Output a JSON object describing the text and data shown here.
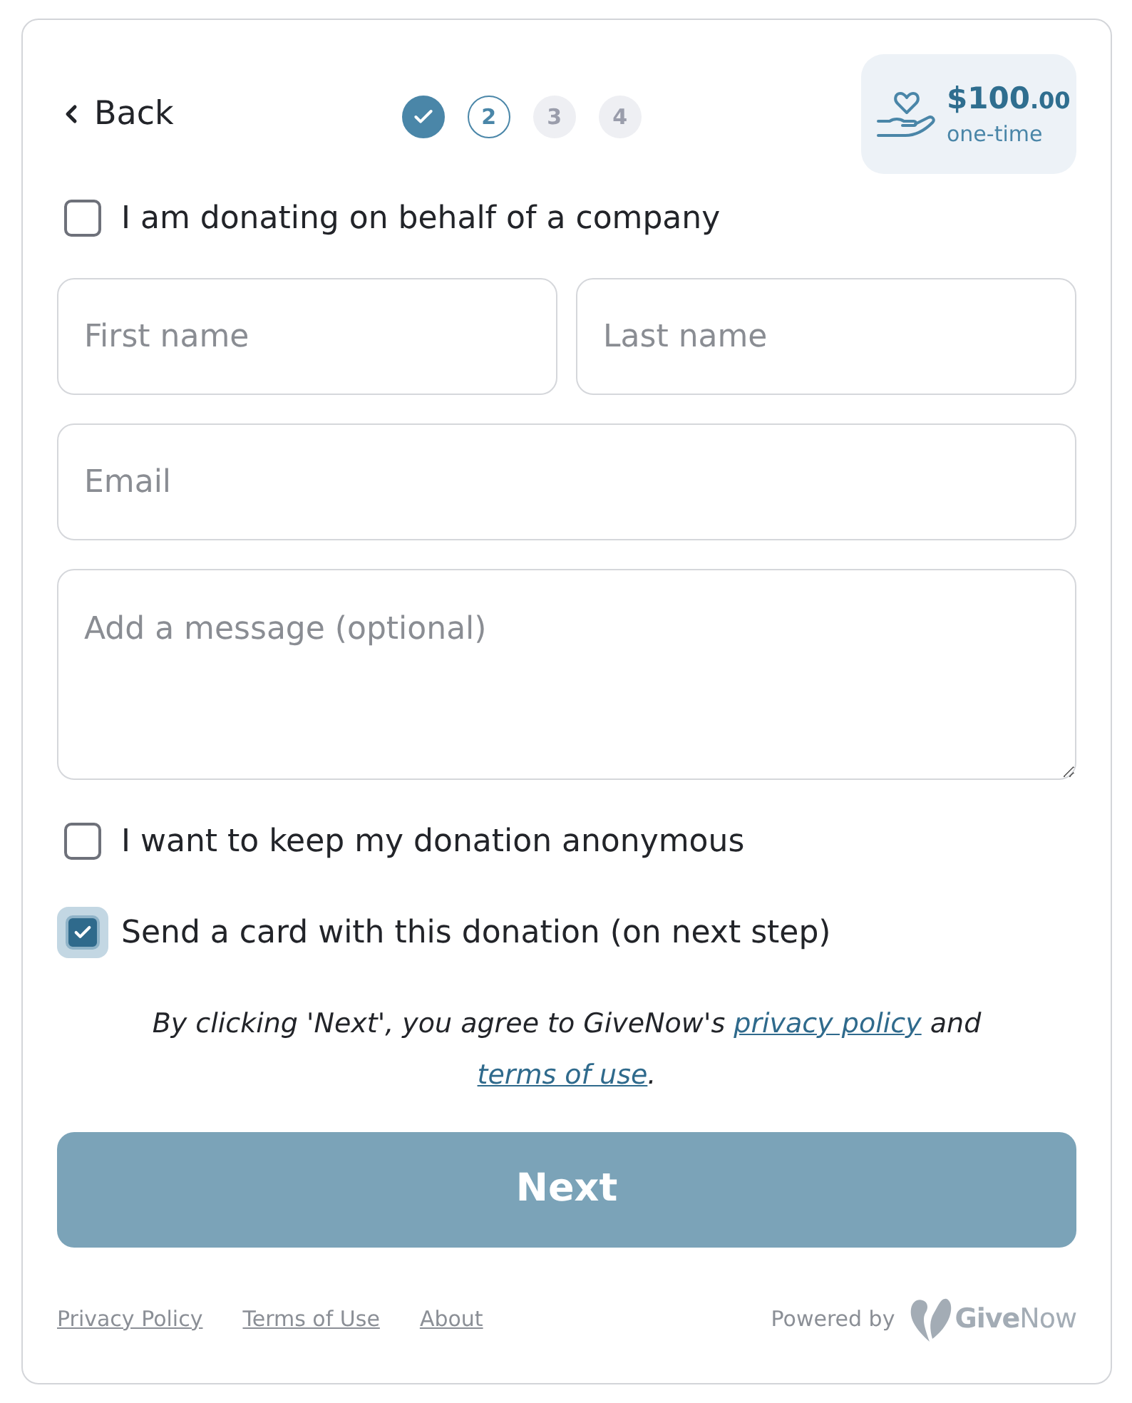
{
  "header": {
    "back_label": "Back",
    "steps": [
      {
        "done": true,
        "selected": false
      },
      {
        "label": "2",
        "done": false,
        "selected": true
      },
      {
        "label": "3",
        "done": false,
        "selected": false
      },
      {
        "label": "4",
        "done": false,
        "selected": false
      }
    ],
    "amount": {
      "whole": "$100",
      "cents": ".00",
      "frequency": "one-time"
    }
  },
  "company_option": {
    "label": "I am donating on behalf of a company",
    "checked": false
  },
  "name_fields": [
    {
      "placeholder": "First name"
    },
    {
      "placeholder": "Last name"
    }
  ],
  "email_field": {
    "placeholder": "Email"
  },
  "message_field": {
    "placeholder": "Add a message (optional)"
  },
  "options": [
    {
      "label": "I want to keep my donation anonymous",
      "checked": false
    },
    {
      "label": "Send a card with this donation (on next step)",
      "checked": true
    }
  ],
  "consent": {
    "text_before": "By clicking 'Next', you agree to GiveNow's",
    "privacy_link": "privacy policy",
    "text_middle": "and",
    "terms_link": "terms of use",
    "text_after": "."
  },
  "next_button": {
    "label": "Next"
  },
  "footer": {
    "links": [
      "Privacy Policy",
      "Terms of Use",
      "About"
    ],
    "powered_by": "Powered by",
    "logo_text": "**Give**Now"
  }
}
